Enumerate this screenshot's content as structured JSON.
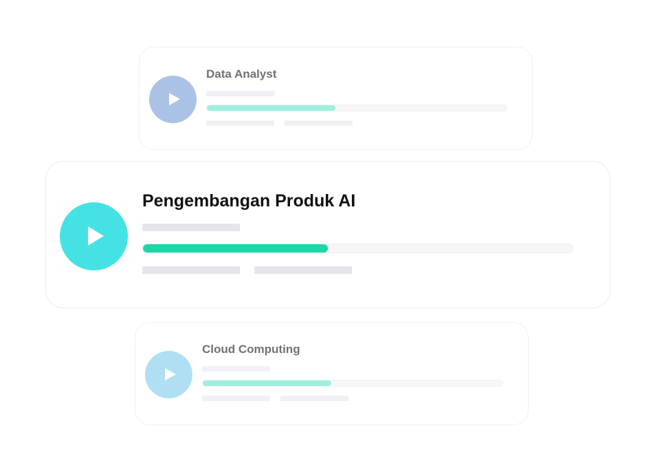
{
  "courses": {
    "top": {
      "title": "Data Analyst",
      "progress_percent": 43,
      "icon": "play-icon",
      "circle_color": "#93b2df",
      "fill_color": "#83ecd5"
    },
    "featured": {
      "title": "Pengembangan Produk AI",
      "progress_percent": 43,
      "icon": "play-icon",
      "circle_color": "#45e2e4",
      "fill_color": "#1cd8a6"
    },
    "bottom": {
      "title": "Cloud Computing",
      "progress_percent": 43,
      "icon": "play-icon",
      "circle_color": "#9ad7f2",
      "fill_color": "#83ecd5"
    }
  }
}
